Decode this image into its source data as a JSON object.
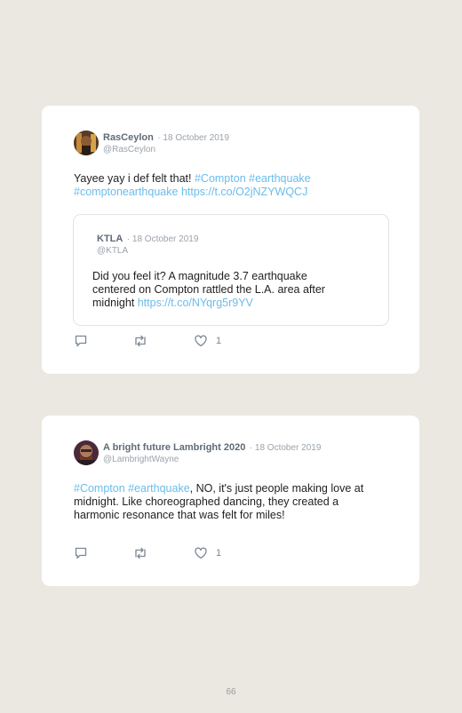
{
  "tweets": [
    {
      "author_name": "RasCeylon",
      "separator_date": "· 18 October 2019",
      "handle": "@RasCeylon",
      "text_plain": "Yayee yay i def felt that! ",
      "text_tags_line1": "#Compton #earthquake",
      "text_tags_line2": "#comptonearthquake",
      "text_link": "https://t.co/O2jNZYWQCJ",
      "quoted": {
        "author_name": "KTLA",
        "separator_date": "· 18 October 2019",
        "handle": "@KTLA",
        "line1": "Did you feel it? A magnitude 3.7 earthquake",
        "line2": "centered on Compton rattled the L.A. area after",
        "line3_plain": "midnight ",
        "line3_link": "https://t.co/NYqrg5r9YV"
      },
      "like_count": "1"
    },
    {
      "author_name": "A bright future Lambright 2020",
      "separator_date": "· 18 October 2019",
      "handle": "@LambrightWayne",
      "text_tags": "#Compton #earthquake",
      "text_line1_rest": ", NO, it's just people making love at",
      "text_line2": "midnight. Like choreographed dancing, they created a",
      "text_line3": "harmonic resonance that was felt for miles!",
      "like_count": "1"
    }
  ],
  "icons": {
    "reply": "speech-bubble",
    "retweet": "retweet-arrows",
    "like": "heart-outline"
  },
  "colors": {
    "page_background": "#ebe8e1",
    "card_background": "#ffffff",
    "link": "#6bbcea",
    "name": "#5f6b78",
    "meta": "#9aa3ac"
  },
  "page_number": "66"
}
